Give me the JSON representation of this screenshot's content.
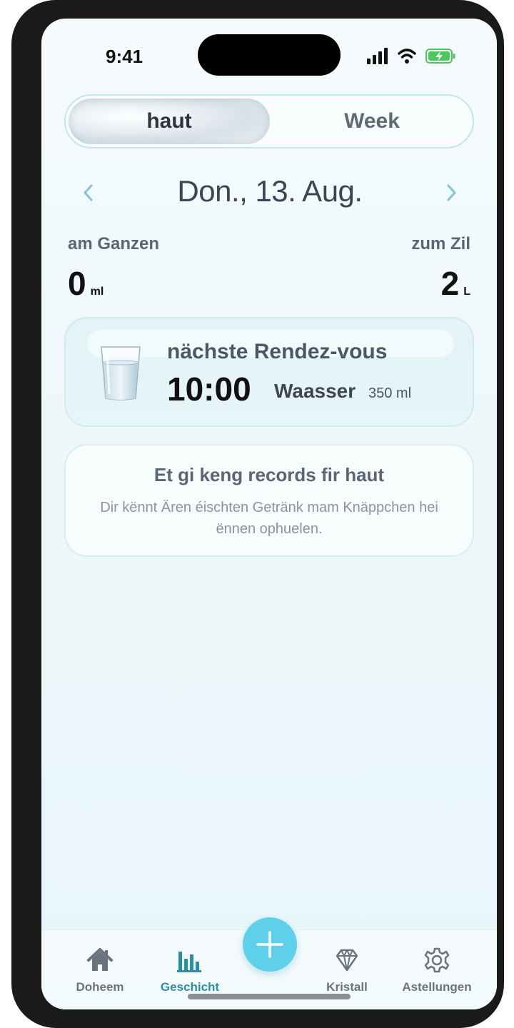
{
  "status_bar": {
    "time": "9:41"
  },
  "segment": {
    "active_label": "haut",
    "other_label": "Week"
  },
  "date_nav": {
    "date": "Don., 13. Aug."
  },
  "summary": {
    "total_label": "am Ganzen",
    "total_value": "0",
    "total_unit": "ml",
    "goal_label": "zum Zil",
    "goal_value": "2",
    "goal_unit": "L"
  },
  "reminder": {
    "title": "nächste Rendez-vous",
    "time": "10:00",
    "drink": "Waasser",
    "amount": "350 ml"
  },
  "empty_state": {
    "title": "Et gi keng records fir haut",
    "description": "Dir kënnt Ären éischten Getränk mam Knäppchen hei ënnen ophuelen."
  },
  "tabbar": {
    "items": [
      {
        "label": "Doheem",
        "icon": "home-icon"
      },
      {
        "label": "Geschicht",
        "icon": "bar-chart-icon",
        "active": true
      },
      {
        "label": "Kristall",
        "icon": "diamond-icon"
      },
      {
        "label": "Astellungen",
        "icon": "gear-icon"
      }
    ],
    "fab_icon": "plus-icon"
  },
  "colors": {
    "accent": "#5fd0ea",
    "active_tab": "#2b8fa4",
    "text_dark": "#111111"
  }
}
